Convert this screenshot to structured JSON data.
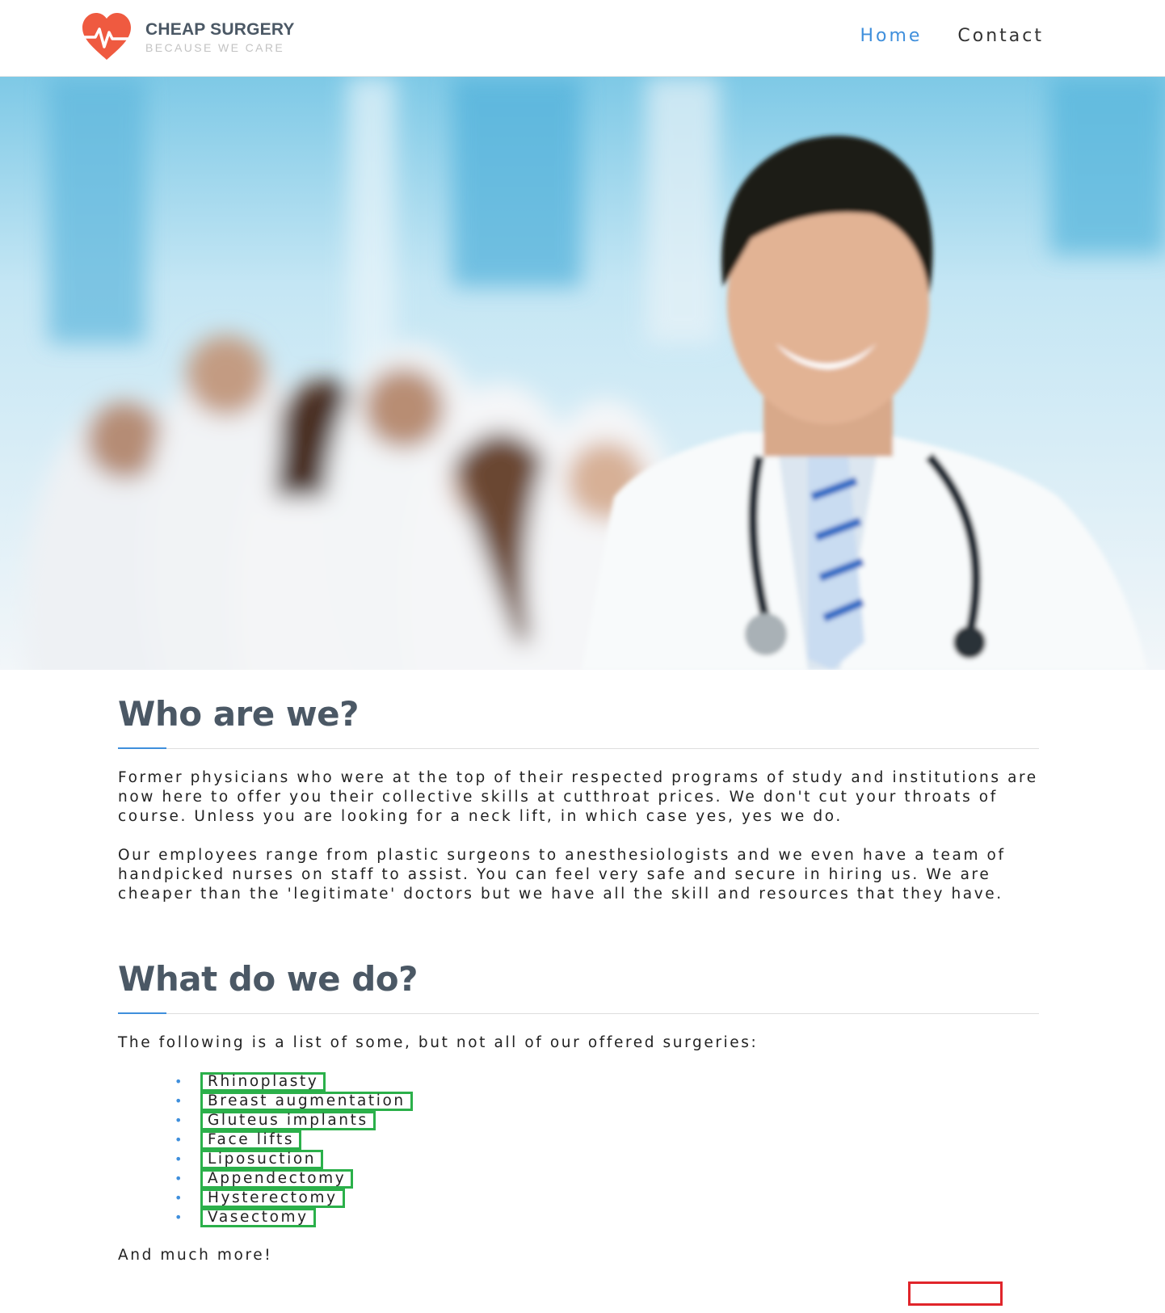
{
  "header": {
    "brand_title": "CHEAP SURGERY",
    "brand_tagline": "BECAUSE WE CARE",
    "nav": [
      {
        "label": "Home",
        "active": true
      },
      {
        "label": "Contact",
        "active": false
      }
    ]
  },
  "about": {
    "title": "Who are we?",
    "paragraphs": [
      "Former physicians who were at the top of their respected programs of study and institutions are now here to offer you their collective skills at cutthroat prices. We don't cut your throats of course. Unless you are looking for a neck lift, in which case yes, yes we do.",
      "Our employees range from plastic surgeons to anesthesiologists and we even have a team of handpicked nurses on staff to assist. You can feel very safe and secure in hiring us. We are cheaper than the 'legitimate' doctors but we have all the skill and resources that they have."
    ]
  },
  "services": {
    "title": "What do we do?",
    "intro": "The following is a list of some, but not all of our offered surgeries:",
    "items": [
      "Rhinoplasty",
      "Breast augmentation",
      "Gluteus implants",
      "Face lifts",
      "Liposuction",
      "Appendectomy",
      "Hysterectomy",
      "Vasectomy"
    ],
    "outro": "And much more!"
  },
  "colors": {
    "accent": "#3f8fdc",
    "heading": "#4b5865",
    "logo_red": "#ef5a40",
    "highlight_green": "#2bb04a",
    "highlight_red": "#e0252b"
  }
}
